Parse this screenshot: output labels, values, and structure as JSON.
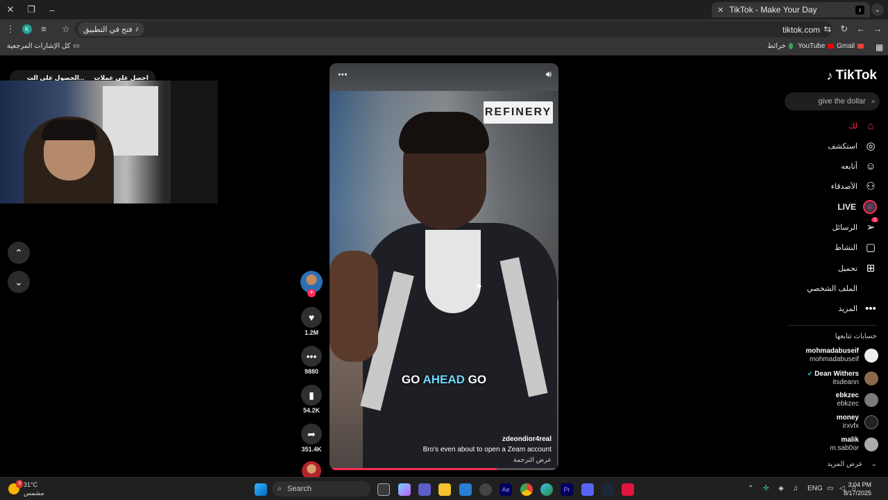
{
  "browser": {
    "tab_title": "TikTok - Make Your Day",
    "url": "tiktok.com",
    "open_in_app": "فتح في التطبيق",
    "profile_initial": "K",
    "bookmarks": {
      "all_bookmarks": "كل الإشارات المرجعية",
      "maps": "خرائط",
      "youtube": "YouTube",
      "gmail": "Gmail"
    }
  },
  "promo": {
    "get_effects": "احصل على عملات",
    "get_on": "الحصول على الت..."
  },
  "video": {
    "store_sign": "REFINERY",
    "caption_pre": "GO ",
    "caption_hl": "AHEAD",
    "caption_post": " GO",
    "author": "zdeondior4real",
    "description": "Bro's even about to open a Zeam account",
    "translate": "عرض الترجمة",
    "progress_fraction": 0.73
  },
  "actions": {
    "likes": "1.2M",
    "comments": "9880",
    "saves": "54.2K",
    "shares": "351.4K"
  },
  "sidebar": {
    "logo": "TikTok",
    "search_placeholder": "give the dollar",
    "nav": {
      "for_you": "لك",
      "explore": "استكشف",
      "following": "أتابعه",
      "friends": "الأصدقاء",
      "live": "LIVE",
      "messages": "الرسائل",
      "messages_badge": "1",
      "activity": "النشاط",
      "upload": "تحميل",
      "profile": "الملف الشخصي",
      "more": "المزيد"
    },
    "following_title": "حسابات تتابعها",
    "following": [
      {
        "name": "mohmadabuseif",
        "handle": "mohmadabuseif"
      },
      {
        "name": "Dean Withers",
        "handle": "itsdeann"
      },
      {
        "name": "ebkzec",
        "handle": "ebkzec"
      },
      {
        "name": "money",
        "handle": "irxvfx"
      },
      {
        "name": "malik",
        "handle": "m.sab0or"
      }
    ],
    "see_more": "عرض المزيد"
  },
  "taskbar": {
    "temperature": "31°C",
    "weather": "مشمس",
    "weather_badge": "3",
    "search": "Search",
    "lang": "ENG",
    "time": "3:04 PM",
    "date": "8/17/2025"
  },
  "colors": {
    "accent": "#fe2c55",
    "caption_highlight": "#72d8ff"
  }
}
